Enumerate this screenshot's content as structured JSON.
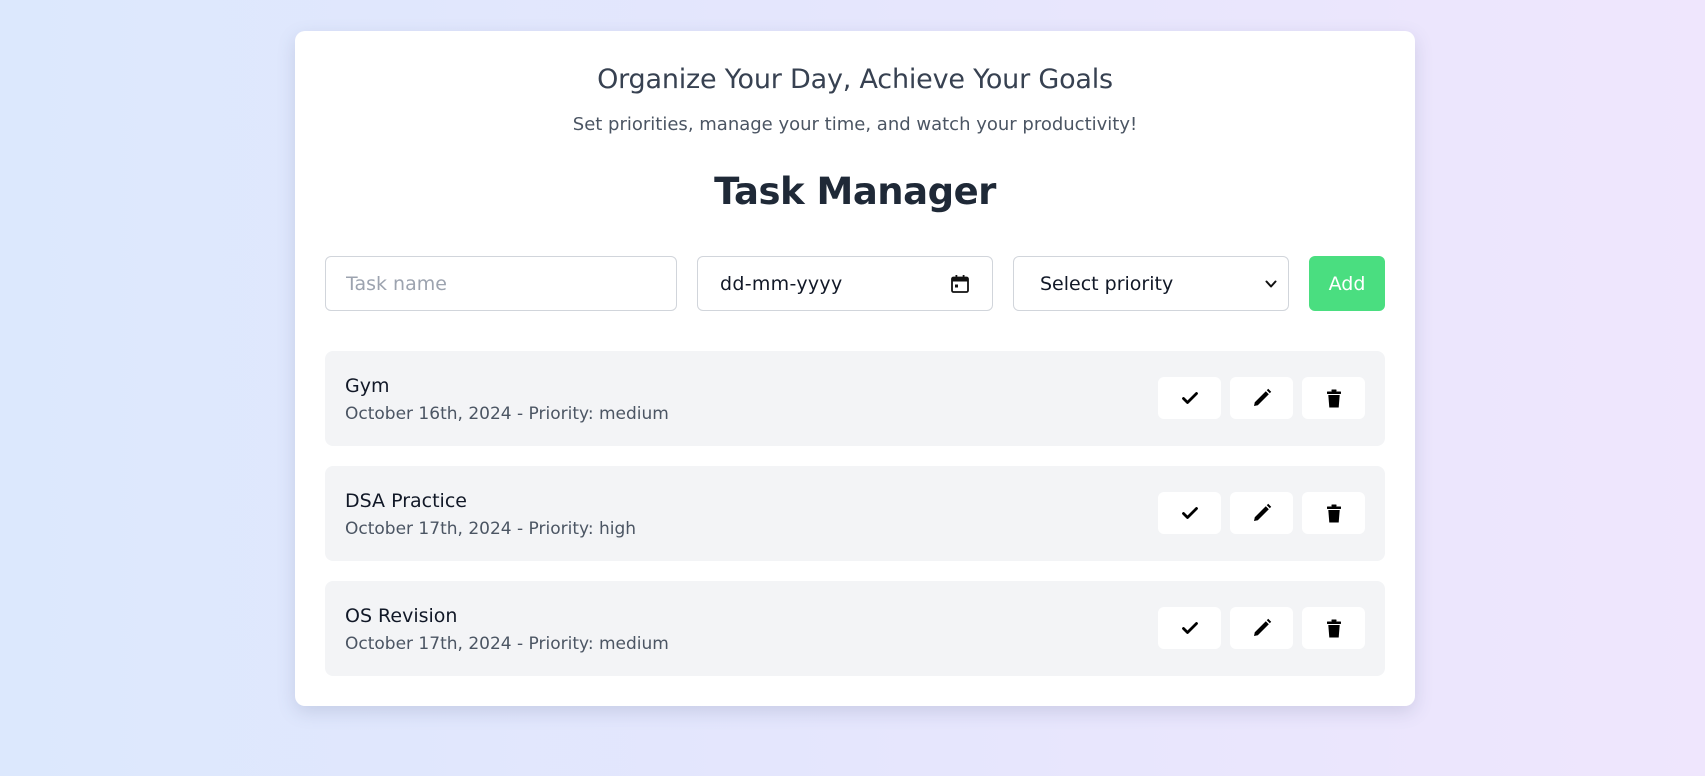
{
  "header": {
    "tagline": "Organize Your Day, Achieve Your Goals",
    "subtitle": "Set priorities, manage your time, and watch your productivity!",
    "title": "Task Manager"
  },
  "form": {
    "task_placeholder": "Task name",
    "date_placeholder": "dd-mm-yyyy",
    "priority_selected": "Select priority",
    "add_label": "Add"
  },
  "tasks": [
    {
      "name": "Gym",
      "date": "October 16th, 2024",
      "priority_label": "Priority:",
      "priority": "medium"
    },
    {
      "name": "DSA Practice",
      "date": "October 17th, 2024",
      "priority_label": "Priority:",
      "priority": "high"
    },
    {
      "name": "OS Revision",
      "date": "October 17th, 2024",
      "priority_label": "Priority:",
      "priority": "medium"
    }
  ],
  "icons": {
    "complete": "check-icon",
    "edit": "pencil-icon",
    "delete": "trash-icon",
    "date": "calendar-icon",
    "select": "chevron-down-icon"
  },
  "colors": {
    "accent": "#4ade80",
    "task_bg": "#f3f4f6",
    "title": "#1f2937"
  }
}
